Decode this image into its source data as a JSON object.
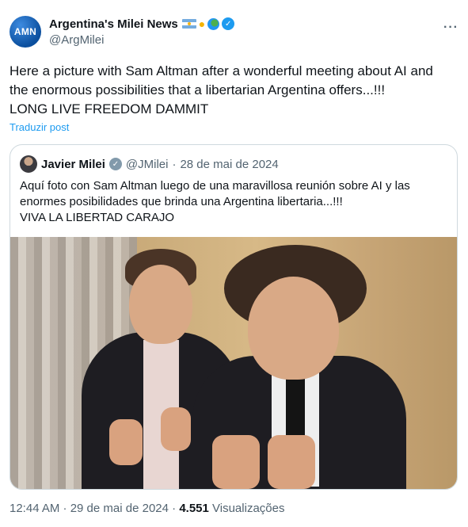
{
  "author": {
    "display_name": "Argentina's Milei News",
    "handle": "@ArgMilei",
    "avatar_text": "AMN",
    "badge_color": "#1d9bf0"
  },
  "tweet": {
    "line1": "Here a picture with Sam Altman after a wonderful meeting about AI and",
    "line2": "the enormous possibilities that a libertarian Argentina offers...!!!",
    "line3": "LONG LIVE FREEDOM DAMMIT",
    "translate_label": "Traduzir post"
  },
  "quote": {
    "display_name": "Javier Milei",
    "handle": "@JMilei",
    "separator": "·",
    "date": "28 de mai de 2024",
    "line1": "Aquí foto con Sam Altman luego de una maravillosa reunión sobre AI y las",
    "line2": "enormes posibilidades que brinda una Argentina libertaria...!!!",
    "line3": "VIVA LA LIBERTAD CARAJO",
    "badge_color": "#829aab"
  },
  "meta": {
    "time_date": "12:44 AM · 29 de mai de 2024 · ",
    "views_count": "4.551",
    "views_label": " Visualizações"
  },
  "icons": [
    "more-icon",
    "verified-icon",
    "argentina-flag-icon",
    "handshake-icon",
    "globe-icon"
  ]
}
